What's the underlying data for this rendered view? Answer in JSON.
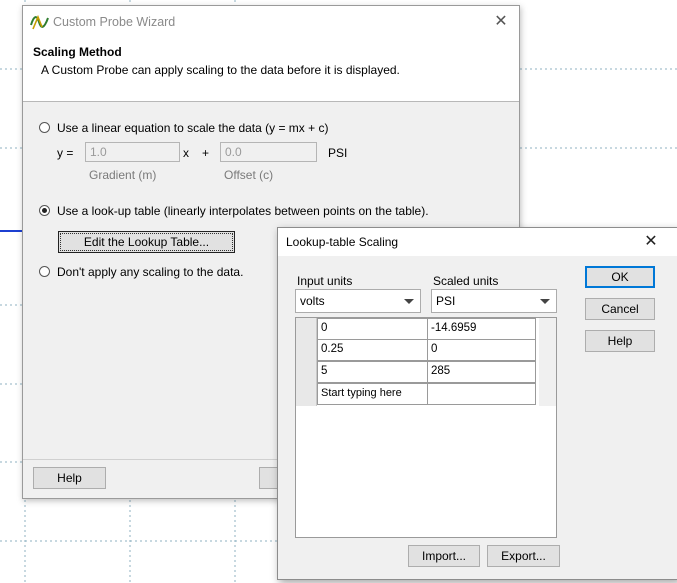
{
  "wizard": {
    "title": "Custom Probe Wizard",
    "heading": "Scaling Method",
    "description": "A Custom Probe can apply scaling to the data before it is displayed.",
    "option_linear_label": "Use a linear equation to scale the data (y = mx + c)",
    "eq_y": "y =",
    "eq_x": "x",
    "eq_plus": "+",
    "gradient_value": "1.0",
    "gradient_label": "Gradient (m)",
    "offset_value": "0.0",
    "offset_label": "Offset (c)",
    "unit_label": "PSI",
    "option_lookup_label": "Use a look-up table (linearly interpolates between points on the table).",
    "edit_lookup_button": "Edit the Lookup Table...",
    "option_none_label": "Don't apply any scaling to the data.",
    "help_button": "Help",
    "selected_option": "lookup"
  },
  "lookup": {
    "title": "Lookup-table Scaling",
    "input_units_label": "Input units",
    "scaled_units_label": "Scaled units",
    "input_units_value": "volts",
    "scaled_units_value": "PSI",
    "rows": [
      {
        "input": "0",
        "scaled": "-14.6959"
      },
      {
        "input": "0.25",
        "scaled": "0"
      },
      {
        "input": "5",
        "scaled": "285"
      },
      {
        "input": "Start typing here",
        "scaled": ""
      }
    ],
    "ok_button": "OK",
    "cancel_button": "Cancel",
    "help_button": "Help",
    "import_button": "Import...",
    "export_button": "Export..."
  },
  "colors": {
    "window_bg": "#f0f0f0",
    "trace_blue": "#1c3fd1"
  }
}
